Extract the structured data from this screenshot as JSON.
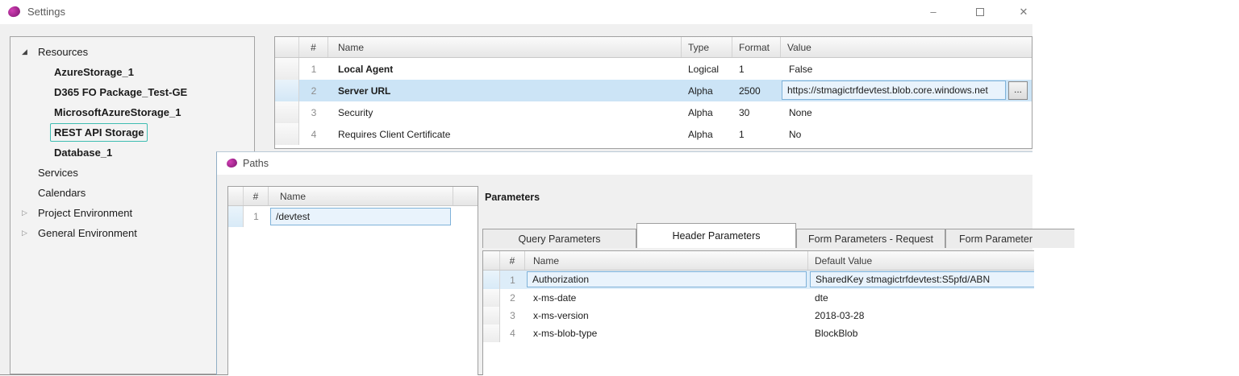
{
  "window": {
    "title": "Settings",
    "minimize_glyph": "–",
    "close_glyph": "✕"
  },
  "tree": {
    "glyphs": {
      "expanded": "◢",
      "collapsed": "▷"
    },
    "items": [
      {
        "label": "Resources"
      },
      {
        "label": "AzureStorage_1"
      },
      {
        "label": "D365 FO Package_Test-GE"
      },
      {
        "label": "MicrosoftAzureStorage_1"
      },
      {
        "label": "REST API Storage"
      },
      {
        "label": "Database_1"
      },
      {
        "label": "Services"
      },
      {
        "label": "Calendars"
      },
      {
        "label": "Project Environment"
      },
      {
        "label": "General Environment"
      }
    ]
  },
  "settings_table": {
    "columns": {
      "num": "#",
      "name": "Name",
      "type": "Type",
      "format": "Format",
      "value": "Value"
    },
    "rows": [
      {
        "num": "1",
        "name": "Local Agent",
        "type": "Logical",
        "format": "1",
        "value": "False"
      },
      {
        "num": "2",
        "name": "Server URL",
        "type": "Alpha",
        "format": "2500",
        "value": "https://stmagictrfdevtest.blob.core.windows.net",
        "ellipsis": "..."
      },
      {
        "num": "3",
        "name": "Security",
        "type": "Alpha",
        "format": "30",
        "value": "None"
      },
      {
        "num": "4",
        "name": "Requires Client Certificate",
        "type": "Alpha",
        "format": "1",
        "value": "No"
      }
    ]
  },
  "paths": {
    "title": "Paths",
    "table": {
      "columns": {
        "num": "#",
        "name": "Name"
      },
      "rows": [
        {
          "num": "1",
          "name": "/devtest"
        }
      ]
    },
    "parameters": {
      "label": "Parameters",
      "tabs": [
        {
          "label": "Query Parameters"
        },
        {
          "label": "Header Parameters"
        },
        {
          "label": "Form Parameters - Request"
        },
        {
          "label": "Form Parameter"
        }
      ],
      "table": {
        "columns": {
          "num": "#",
          "name": "Name",
          "value": "Default Value"
        },
        "rows": [
          {
            "num": "1",
            "name": "Authorization",
            "value": "SharedKey stmagictrfdevtest:S5pfd/ABN"
          },
          {
            "num": "2",
            "name": "x-ms-date",
            "value": "dte"
          },
          {
            "num": "3",
            "name": "x-ms-version",
            "value": "2018-03-28"
          },
          {
            "num": "4",
            "name": "x-ms-blob-type",
            "value": "BlockBlob"
          }
        ]
      }
    }
  },
  "colors": {
    "selection_blue": "#cce4f6",
    "field_blue": "#e9f3fc",
    "field_border": "#7fb2d9",
    "tree_selection_teal": "#3fbdb2",
    "accent_purple": "#a2248f"
  }
}
